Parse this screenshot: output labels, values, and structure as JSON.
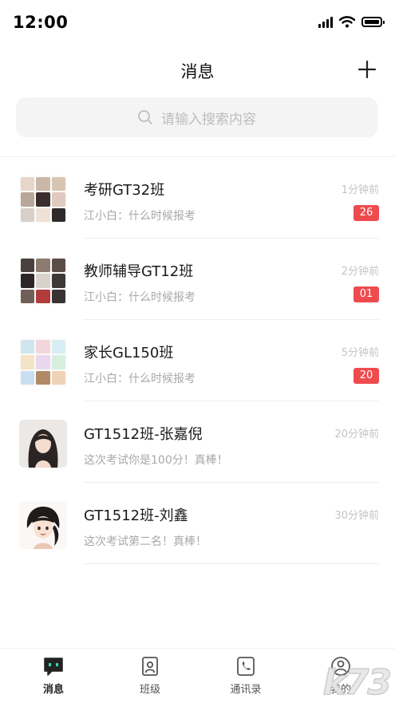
{
  "status_bar": {
    "time": "12:00"
  },
  "nav": {
    "title": "消息"
  },
  "search": {
    "placeholder": "请输入搜索内容"
  },
  "conversations": [
    {
      "title": "考研GT32班",
      "subtitle": "江小白：什么时候报考",
      "time": "1分钟前",
      "badge": "26"
    },
    {
      "title": "教师辅导GT12班",
      "subtitle": "江小白：什么时候报考",
      "time": "2分钟前",
      "badge": "01"
    },
    {
      "title": "家长GL150班",
      "subtitle": "江小白：什么时候报考",
      "time": "5分钟前",
      "badge": "20"
    },
    {
      "title": "GT1512班-张嘉倪",
      "subtitle": "这次考试你是100分！真棒！",
      "time": "20分钟前",
      "badge": ""
    },
    {
      "title": "GT1512班-刘鑫",
      "subtitle": "这次考试第二名！真棒！",
      "time": "30分钟前",
      "badge": ""
    }
  ],
  "tabs": [
    {
      "label": "消息",
      "icon": "chat-icon",
      "active": true
    },
    {
      "label": "班级",
      "icon": "class-icon",
      "active": false
    },
    {
      "label": "通讯录",
      "icon": "contacts-icon",
      "active": false
    },
    {
      "label": "我的",
      "icon": "profile-icon",
      "active": false
    }
  ],
  "watermark": "k73",
  "colors": {
    "badge": "#ef4b4f",
    "accent": "#2b2b2b"
  }
}
